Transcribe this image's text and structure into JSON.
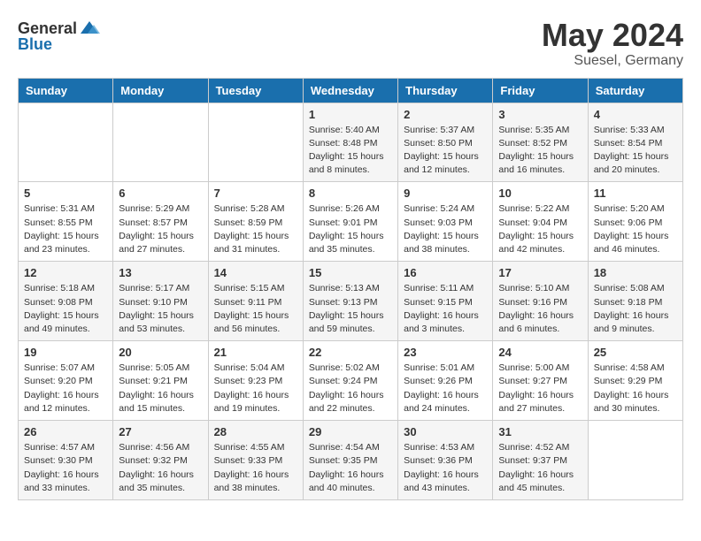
{
  "header": {
    "logo_general": "General",
    "logo_blue": "Blue",
    "month": "May 2024",
    "location": "Suesel, Germany"
  },
  "weekdays": [
    "Sunday",
    "Monday",
    "Tuesday",
    "Wednesday",
    "Thursday",
    "Friday",
    "Saturday"
  ],
  "weeks": [
    [
      {
        "day": "",
        "info": ""
      },
      {
        "day": "",
        "info": ""
      },
      {
        "day": "",
        "info": ""
      },
      {
        "day": "1",
        "info": "Sunrise: 5:40 AM\nSunset: 8:48 PM\nDaylight: 15 hours\nand 8 minutes."
      },
      {
        "day": "2",
        "info": "Sunrise: 5:37 AM\nSunset: 8:50 PM\nDaylight: 15 hours\nand 12 minutes."
      },
      {
        "day": "3",
        "info": "Sunrise: 5:35 AM\nSunset: 8:52 PM\nDaylight: 15 hours\nand 16 minutes."
      },
      {
        "day": "4",
        "info": "Sunrise: 5:33 AM\nSunset: 8:54 PM\nDaylight: 15 hours\nand 20 minutes."
      }
    ],
    [
      {
        "day": "5",
        "info": "Sunrise: 5:31 AM\nSunset: 8:55 PM\nDaylight: 15 hours\nand 23 minutes."
      },
      {
        "day": "6",
        "info": "Sunrise: 5:29 AM\nSunset: 8:57 PM\nDaylight: 15 hours\nand 27 minutes."
      },
      {
        "day": "7",
        "info": "Sunrise: 5:28 AM\nSunset: 8:59 PM\nDaylight: 15 hours\nand 31 minutes."
      },
      {
        "day": "8",
        "info": "Sunrise: 5:26 AM\nSunset: 9:01 PM\nDaylight: 15 hours\nand 35 minutes."
      },
      {
        "day": "9",
        "info": "Sunrise: 5:24 AM\nSunset: 9:03 PM\nDaylight: 15 hours\nand 38 minutes."
      },
      {
        "day": "10",
        "info": "Sunrise: 5:22 AM\nSunset: 9:04 PM\nDaylight: 15 hours\nand 42 minutes."
      },
      {
        "day": "11",
        "info": "Sunrise: 5:20 AM\nSunset: 9:06 PM\nDaylight: 15 hours\nand 46 minutes."
      }
    ],
    [
      {
        "day": "12",
        "info": "Sunrise: 5:18 AM\nSunset: 9:08 PM\nDaylight: 15 hours\nand 49 minutes."
      },
      {
        "day": "13",
        "info": "Sunrise: 5:17 AM\nSunset: 9:10 PM\nDaylight: 15 hours\nand 53 minutes."
      },
      {
        "day": "14",
        "info": "Sunrise: 5:15 AM\nSunset: 9:11 PM\nDaylight: 15 hours\nand 56 minutes."
      },
      {
        "day": "15",
        "info": "Sunrise: 5:13 AM\nSunset: 9:13 PM\nDaylight: 15 hours\nand 59 minutes."
      },
      {
        "day": "16",
        "info": "Sunrise: 5:11 AM\nSunset: 9:15 PM\nDaylight: 16 hours\nand 3 minutes."
      },
      {
        "day": "17",
        "info": "Sunrise: 5:10 AM\nSunset: 9:16 PM\nDaylight: 16 hours\nand 6 minutes."
      },
      {
        "day": "18",
        "info": "Sunrise: 5:08 AM\nSunset: 9:18 PM\nDaylight: 16 hours\nand 9 minutes."
      }
    ],
    [
      {
        "day": "19",
        "info": "Sunrise: 5:07 AM\nSunset: 9:20 PM\nDaylight: 16 hours\nand 12 minutes."
      },
      {
        "day": "20",
        "info": "Sunrise: 5:05 AM\nSunset: 9:21 PM\nDaylight: 16 hours\nand 15 minutes."
      },
      {
        "day": "21",
        "info": "Sunrise: 5:04 AM\nSunset: 9:23 PM\nDaylight: 16 hours\nand 19 minutes."
      },
      {
        "day": "22",
        "info": "Sunrise: 5:02 AM\nSunset: 9:24 PM\nDaylight: 16 hours\nand 22 minutes."
      },
      {
        "day": "23",
        "info": "Sunrise: 5:01 AM\nSunset: 9:26 PM\nDaylight: 16 hours\nand 24 minutes."
      },
      {
        "day": "24",
        "info": "Sunrise: 5:00 AM\nSunset: 9:27 PM\nDaylight: 16 hours\nand 27 minutes."
      },
      {
        "day": "25",
        "info": "Sunrise: 4:58 AM\nSunset: 9:29 PM\nDaylight: 16 hours\nand 30 minutes."
      }
    ],
    [
      {
        "day": "26",
        "info": "Sunrise: 4:57 AM\nSunset: 9:30 PM\nDaylight: 16 hours\nand 33 minutes."
      },
      {
        "day": "27",
        "info": "Sunrise: 4:56 AM\nSunset: 9:32 PM\nDaylight: 16 hours\nand 35 minutes."
      },
      {
        "day": "28",
        "info": "Sunrise: 4:55 AM\nSunset: 9:33 PM\nDaylight: 16 hours\nand 38 minutes."
      },
      {
        "day": "29",
        "info": "Sunrise: 4:54 AM\nSunset: 9:35 PM\nDaylight: 16 hours\nand 40 minutes."
      },
      {
        "day": "30",
        "info": "Sunrise: 4:53 AM\nSunset: 9:36 PM\nDaylight: 16 hours\nand 43 minutes."
      },
      {
        "day": "31",
        "info": "Sunrise: 4:52 AM\nSunset: 9:37 PM\nDaylight: 16 hours\nand 45 minutes."
      },
      {
        "day": "",
        "info": ""
      }
    ]
  ]
}
